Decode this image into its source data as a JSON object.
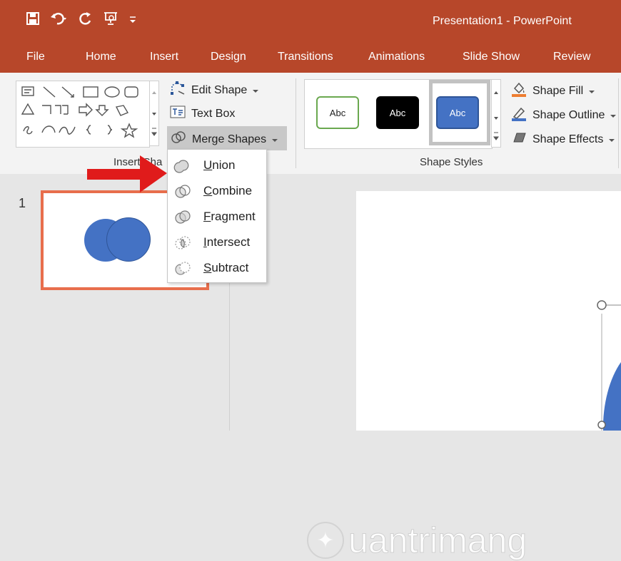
{
  "window": {
    "title": "Presentation1  -  PowerPoint"
  },
  "quick_access": {
    "items": [
      "save-icon",
      "undo-icon",
      "redo-icon",
      "start-from-beginning-icon",
      "customize-icon"
    ]
  },
  "tabs": [
    {
      "label": "File"
    },
    {
      "label": "Home"
    },
    {
      "label": "Insert"
    },
    {
      "label": "Design"
    },
    {
      "label": "Transitions"
    },
    {
      "label": "Animations"
    },
    {
      "label": "Slide Show"
    },
    {
      "label": "Review"
    }
  ],
  "ribbon": {
    "insert_shapes": {
      "label": "Insert Sha",
      "edit_shape": "Edit Shape",
      "text_box": "Text Box",
      "merge_shapes": "Merge Shapes"
    },
    "shape_styles": {
      "label": "Shape Styles",
      "samples": [
        {
          "label": "Abc",
          "fill": "#ffffff",
          "border": "#6aa84f",
          "text": "#222222"
        },
        {
          "label": "Abc",
          "fill": "#000000",
          "border": "#000000",
          "text": "#ffffff"
        },
        {
          "label": "Abc",
          "fill": "#4472c4",
          "border": "#2f5597",
          "text": "#ffffff"
        }
      ],
      "shape_fill": "Shape Fill",
      "shape_outline": "Shape Outline",
      "shape_effects": "Shape Effects"
    }
  },
  "merge_menu": {
    "items": [
      {
        "label": "Union",
        "icon": "union-icon"
      },
      {
        "label": "Combine",
        "icon": "combine-icon"
      },
      {
        "label": "Fragment",
        "icon": "fragment-icon"
      },
      {
        "label": "Intersect",
        "icon": "intersect-icon"
      },
      {
        "label": "Subtract",
        "icon": "subtract-icon"
      }
    ]
  },
  "slides": {
    "thumbnail_number": "1"
  },
  "watermark": {
    "text": "uantrimang"
  },
  "colors": {
    "accent": "#b7472a",
    "shape_blue": "#4472c4",
    "selected_slide_border": "#e86e4c",
    "annotation_arrow": "#e01b1b"
  }
}
